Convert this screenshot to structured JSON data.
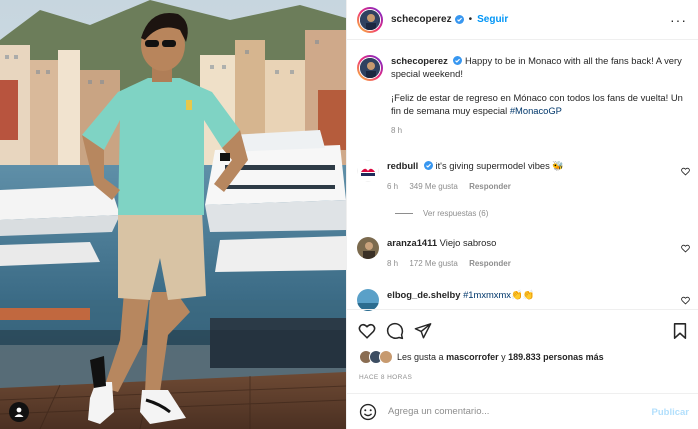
{
  "post": {
    "username": "schecoperez",
    "follow_label": "Seguir",
    "separator": "•",
    "more_label": "···"
  },
  "caption": {
    "username": "schecoperez",
    "text_en": "Happy to be in Monaco with all the fans back! A very special weekend!",
    "text_es": "¡Feliz de estar de regreso en Mónaco con todos los fans de vuelta! Un fin de semana muy especial",
    "hashtag": "#MonacoGP",
    "time": "8 h"
  },
  "comments": [
    {
      "username": "redbull",
      "text": "it's giving supermodel vibes 🐝",
      "time": "6 h",
      "likes": "349 Me gusta",
      "reply": "Responder"
    },
    {
      "username": "aranza1411",
      "text": "Viejo sabroso",
      "time": "8 h",
      "likes": "172 Me gusta",
      "reply": "Responder"
    },
    {
      "username": "elbog_de.shelby",
      "hashtag": "#1mxmxmx",
      "emoji": "👏👏"
    }
  ],
  "replies_label": "Ver respuestas (6)",
  "likes": {
    "prefix": "Les gusta a",
    "user": "mascorrofer",
    "joiner": "y",
    "count": "189.833 personas más"
  },
  "time_ago": "HACE 8 HORAS",
  "comment_box": {
    "placeholder": "Agrega un comentario...",
    "publish_label": "Publicar"
  },
  "colors": {
    "accent": "#0095f6",
    "publish_disabled": "#b2dffc",
    "link": "#00376b"
  }
}
